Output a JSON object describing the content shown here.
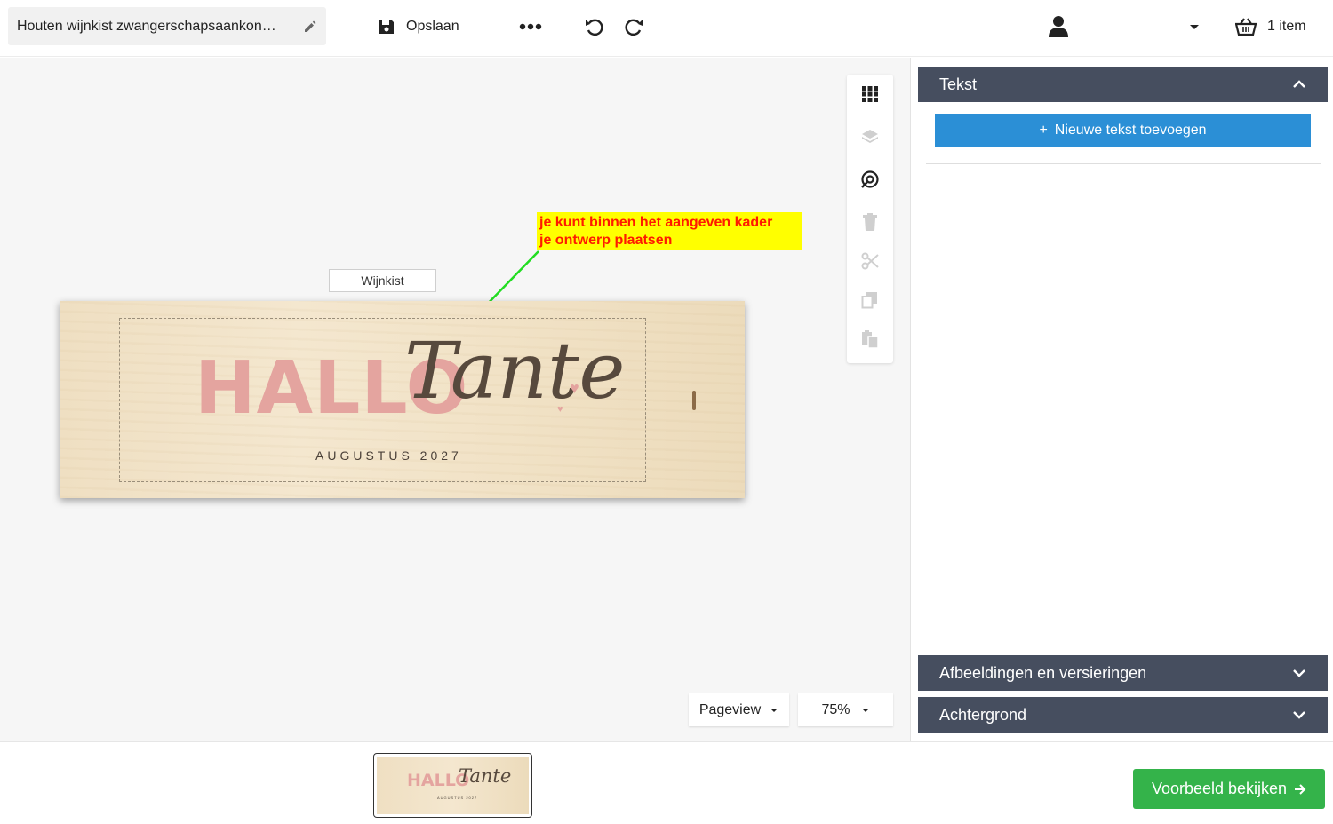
{
  "header": {
    "document_title": "Houten wijnkist zwangerschapsaankon…",
    "save_label": "Opslaan",
    "cart_label": "1 item"
  },
  "icons": {
    "edit": "pencil-icon",
    "save": "floppy-disk-icon",
    "more": "ellipsis-icon",
    "undo": "undo-icon",
    "redo": "redo-icon",
    "user": "user-icon",
    "caret": "caret-down-icon",
    "cart": "basket-icon"
  },
  "canvas": {
    "product_label": "Wijnkist",
    "annotation": {
      "line1": "je kunt binnen het aangeven kader",
      "line2": "je ontwerp plaatsen",
      "background": "#ffff00",
      "text_color": "#ff1a00",
      "arrow_color": "#22dd22"
    },
    "design": {
      "hallo": "HALLO",
      "tante": "Tante",
      "date": "AUGUSTUS 2027",
      "hallo_color": "#e4a49f",
      "tante_color": "#57493d"
    },
    "view_mode": "Pageview",
    "zoom": "75%"
  },
  "toolbox": {
    "tools": [
      "grid-icon",
      "layers-icon",
      "recenter-icon",
      "trash-icon",
      "scissors-icon",
      "copy-icon",
      "paste-icon"
    ]
  },
  "panel": {
    "sections": [
      {
        "label": "Tekst",
        "expanded": true
      },
      {
        "label": "Afbeeldingen en versieringen",
        "expanded": false
      },
      {
        "label": "Achtergrond",
        "expanded": false
      }
    ],
    "add_text_label": "Nieuwe tekst toevoegen",
    "header_color": "#464e5f",
    "add_button_color": "#2b8fd6"
  },
  "bottom": {
    "preview_label": "Voorbeeld bekijken",
    "preview_color": "#34b34a",
    "thumbnail": {
      "hallo": "HALLO",
      "tante": "Tante",
      "date": "AUGUSTUS 2027"
    }
  }
}
